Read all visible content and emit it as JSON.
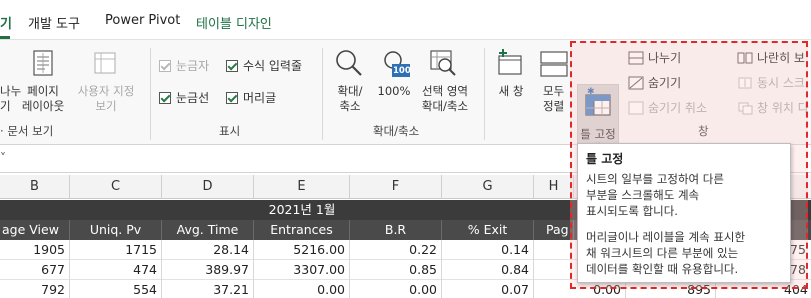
{
  "tabs": [
    {
      "label": "기",
      "active": true
    },
    {
      "label": "개발 도구"
    },
    {
      "label": "Power Pivot"
    },
    {
      "label": "테이블 디자인",
      "accent": true
    }
  ],
  "ribbon": {
    "workbook_view": {
      "split_label_1": "나누",
      "split_label_2": "기",
      "page_layout_label_1": "페이지",
      "page_layout_label_2": "레이아웃",
      "custom_view_label_1": "사용자 지정",
      "custom_view_label_2": "보기",
      "group_label": "문서 보기"
    },
    "show": {
      "ruler": "눈금자",
      "formula_bar": "수식 입력줄",
      "gridlines": "눈금선",
      "headings": "머리글",
      "group_label": "표시"
    },
    "zoom": {
      "zoom_label_1": "확대/",
      "zoom_label_2": "축소",
      "hundred_label": "100%",
      "hundred_icon_text": "100",
      "zoom_selection_label_1": "선택 영역",
      "zoom_selection_label_2": "확대/축소",
      "group_label": "확대/축소"
    },
    "window": {
      "new_window": "새 창",
      "arrange_1": "모두",
      "arrange_2": "정렬",
      "freeze_panes_1": "틀 고정",
      "freeze_panes_2": "˅",
      "split": "나누기",
      "hide": "숨기기",
      "unhide": "숨기기 취소",
      "side_by_side": "나란히 보",
      "sync_scroll": "동시 스크",
      "reset_position": "창 위치 다",
      "group_label": "창"
    }
  },
  "formula_bar": {
    "chevron": "˅"
  },
  "columns": [
    "B",
    "C",
    "D",
    "E",
    "F",
    "G",
    "H"
  ],
  "table": {
    "group_header": "2021년 1월",
    "headers": [
      "age View",
      "Uniq. Pv",
      "Avg. Time",
      "Entrances",
      "B.R",
      "% Exit",
      "Pag"
    ],
    "rows": [
      {
        "page_view": "1905",
        "uniq_pv": "1715",
        "avg_time": "28.14",
        "entrances": "5216.00",
        "br": "0.22",
        "exit": "0.14",
        "right": "75"
      },
      {
        "page_view": "677",
        "uniq_pv": "474",
        "avg_time": "389.97",
        "entrances": "3307.00",
        "br": "0.85",
        "exit": "0.84",
        "right": "78"
      },
      {
        "page_view": "792",
        "uniq_pv": "554",
        "avg_time": "37.21",
        "entrances": "0.00",
        "br": "0.00",
        "exit": "0.07",
        "pag": "0.00",
        "h": "895",
        "right": "404"
      }
    ]
  },
  "tooltip": {
    "title": "틀 고정",
    "para1": "시트의 일부를 고정하여 다른\n부분을 스크롤해도 계속\n표시되도록 합니다.",
    "para2": "머리글이나 레이블을 계속 표시한\n채 워크시트의 다른 부분에 있는\n데이터를 확인할 때 유용합니다."
  },
  "colors": {
    "accent_green": "#1e7145",
    "highlight_red": "#e0282a",
    "table_header_bg": "#3b3b3b"
  }
}
